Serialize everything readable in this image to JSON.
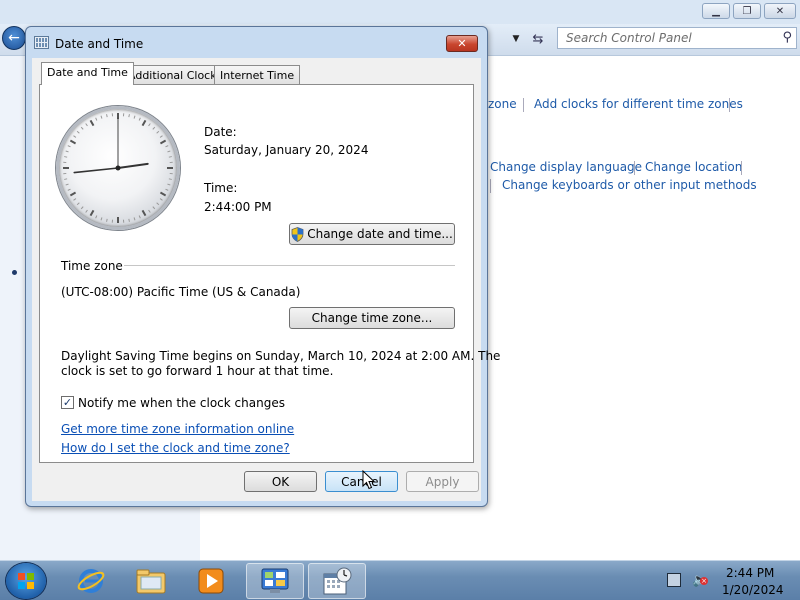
{
  "control_panel": {
    "search": {
      "placeholder": "Search Control Panel"
    },
    "links": {
      "time_zone_partial": "zone",
      "add_clocks": "Add clocks for different time zones",
      "change_display_language": "Change display language",
      "change_location": "Change location",
      "change_keyboards": "Change keyboards or other input methods"
    }
  },
  "dialog": {
    "title": "Date and Time",
    "tabs": [
      "Date and Time",
      "Additional Clocks",
      "Internet Time"
    ],
    "date_label": "Date:",
    "date_value": "Saturday, January 20, 2024",
    "time_label": "Time:",
    "time_value": "2:44:00 PM",
    "change_date_time_button": "Change date and time...",
    "time_zone_heading": "Time zone",
    "time_zone_value": "(UTC-08:00) Pacific Time (US & Canada)",
    "change_time_zone_button": "Change time zone...",
    "dst_line1": "Daylight Saving Time begins on Sunday, March 10, 2024 at 2:00 AM. The",
    "dst_line2": "clock is set to go forward 1 hour at that time.",
    "notify_checkbox_label": "Notify me when the clock changes",
    "notify_checked": true,
    "link_more_info": "Get more time zone information online",
    "link_how_set": "How do I set the clock and time zone?",
    "ok_button": "OK",
    "cancel_button": "Cancel",
    "apply_button": "Apply",
    "clock": {
      "hour": 2,
      "minute": 44,
      "second": 0
    }
  },
  "taskbar": {
    "icons": [
      "start-orb-icon",
      "internet-explorer-icon",
      "file-explorer-icon",
      "media-player-icon",
      "control-panel-icon",
      "date-time-icon"
    ],
    "tray_time": "2:44 PM",
    "tray_date": "1/20/2024"
  },
  "colors": {
    "link": "#1e5aa8",
    "dialog_frame": "#c7dbf1",
    "taskbar": "#6a8db3"
  }
}
